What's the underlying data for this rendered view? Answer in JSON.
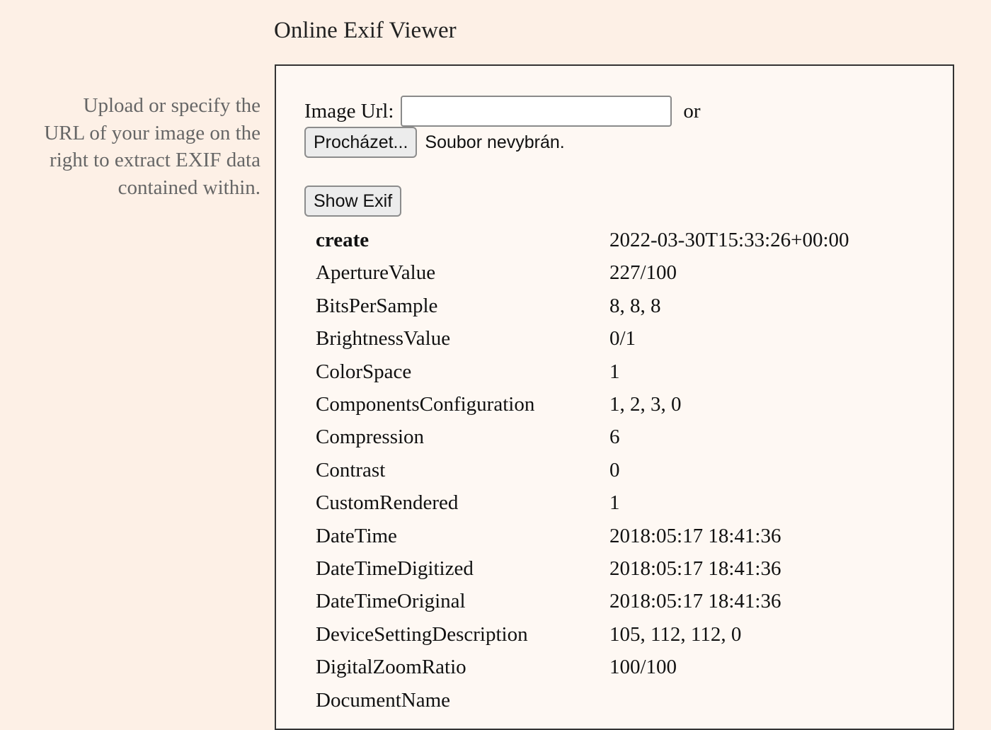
{
  "page_title": "Online Exif Viewer",
  "sidebar": {
    "lines": [
      "Upload or specify the",
      "URL of your image on the",
      "right to extract EXIF data",
      "contained within."
    ]
  },
  "form": {
    "url_label": "Image Url:",
    "url_value": "",
    "url_placeholder": "",
    "or_text": "or",
    "browse_label": "Procházet...",
    "file_status": "Soubor nevybrán.",
    "show_exif_label": "Show Exif"
  },
  "exif": {
    "rows": [
      {
        "key": "create",
        "value": "2022-03-30T15:33:26+00:00"
      },
      {
        "key": "ApertureValue",
        "value": "227/100"
      },
      {
        "key": "BitsPerSample",
        "value": "8, 8, 8"
      },
      {
        "key": "BrightnessValue",
        "value": "0/1"
      },
      {
        "key": "ColorSpace",
        "value": "1"
      },
      {
        "key": "ComponentsConfiguration",
        "value": "1, 2, 3, 0"
      },
      {
        "key": "Compression",
        "value": "6"
      },
      {
        "key": "Contrast",
        "value": "0"
      },
      {
        "key": "CustomRendered",
        "value": "1"
      },
      {
        "key": "DateTime",
        "value": "2018:05:17 18:41:36"
      },
      {
        "key": "DateTimeDigitized",
        "value": "2018:05:17 18:41:36"
      },
      {
        "key": "DateTimeOriginal",
        "value": "2018:05:17 18:41:36"
      },
      {
        "key": "DeviceSettingDescription",
        "value": "105, 112, 112, 0"
      },
      {
        "key": "DigitalZoomRatio",
        "value": "100/100"
      },
      {
        "key": "DocumentName",
        "value": ""
      }
    ]
  }
}
